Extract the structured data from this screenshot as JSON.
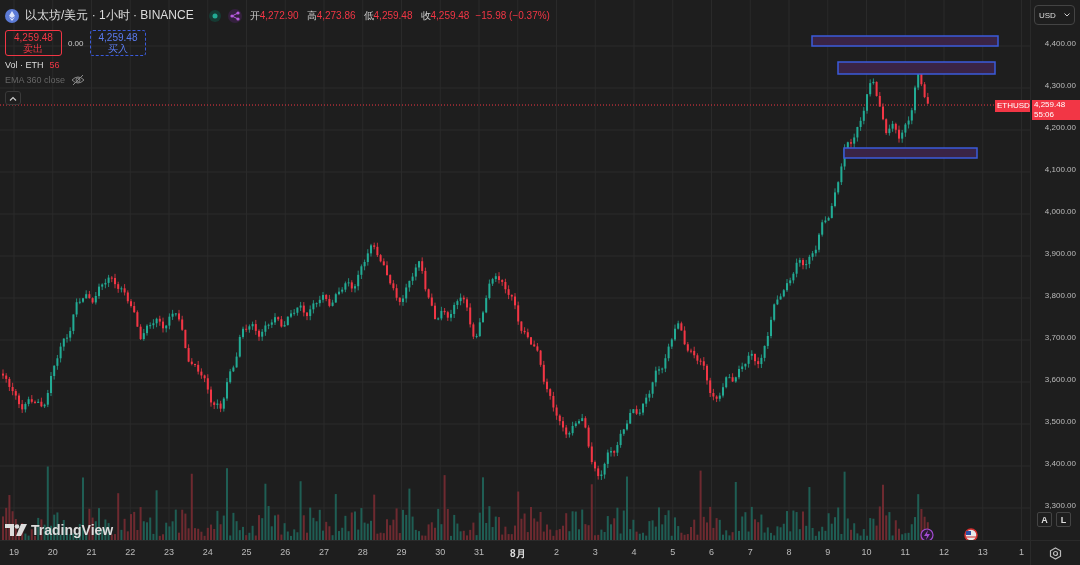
{
  "header": {
    "symbol": "以太坊/美元 · 1小时 · BINANCE",
    "ohlc": [
      {
        "label": "开",
        "value": "4,272.90"
      },
      {
        "label": "高",
        "value": "4,273.86"
      },
      {
        "label": "低",
        "value": "4,259.48"
      },
      {
        "label": "收",
        "value": "4,259.48"
      }
    ],
    "change": "−15.98 (−0.37%)"
  },
  "trade": {
    "sell_price": "4,259.48",
    "sell_label": "卖出",
    "spread": "0.00",
    "buy_price": "4,259.48",
    "buy_label": "买入"
  },
  "indicators": [
    {
      "name": "Vol · ETH",
      "value": "56",
      "hidden": false
    },
    {
      "name": "EMA 360 close",
      "hidden": true
    }
  ],
  "currency": "USD",
  "price_axis": [
    "4,400.00",
    "4,300.00",
    "4,200.00",
    "4,100.00",
    "4,000.00",
    "3,900.00",
    "3,800.00",
    "3,700.00",
    "3,600.00",
    "3,500.00",
    "3,400.00",
    "3,300.00"
  ],
  "last_price": {
    "symbol": "ETHUSD",
    "price": "4,259.48",
    "countdown": "55:06"
  },
  "time_axis": [
    {
      "label": "19",
      "kind": "day"
    },
    {
      "label": "20",
      "kind": "day"
    },
    {
      "label": "21",
      "kind": "day"
    },
    {
      "label": "22",
      "kind": "day"
    },
    {
      "label": "23",
      "kind": "day"
    },
    {
      "label": "24",
      "kind": "day"
    },
    {
      "label": "25",
      "kind": "day"
    },
    {
      "label": "26",
      "kind": "day"
    },
    {
      "label": "27",
      "kind": "day"
    },
    {
      "label": "28",
      "kind": "day"
    },
    {
      "label": "29",
      "kind": "day"
    },
    {
      "label": "30",
      "kind": "day"
    },
    {
      "label": "31",
      "kind": "day"
    },
    {
      "label": "8月",
      "kind": "month"
    },
    {
      "label": "2",
      "kind": "day"
    },
    {
      "label": "3",
      "kind": "day"
    },
    {
      "label": "4",
      "kind": "day"
    },
    {
      "label": "5",
      "kind": "day"
    },
    {
      "label": "6",
      "kind": "day"
    },
    {
      "label": "7",
      "kind": "day"
    },
    {
      "label": "8",
      "kind": "day"
    },
    {
      "label": "9",
      "kind": "day"
    },
    {
      "label": "10",
      "kind": "day"
    },
    {
      "label": "11",
      "kind": "day"
    },
    {
      "label": "12",
      "kind": "day"
    },
    {
      "label": "13",
      "kind": "day"
    },
    {
      "label": "1",
      "kind": "day"
    }
  ],
  "scale_buttons": [
    "A",
    "L"
  ],
  "logo": "TradingView"
}
